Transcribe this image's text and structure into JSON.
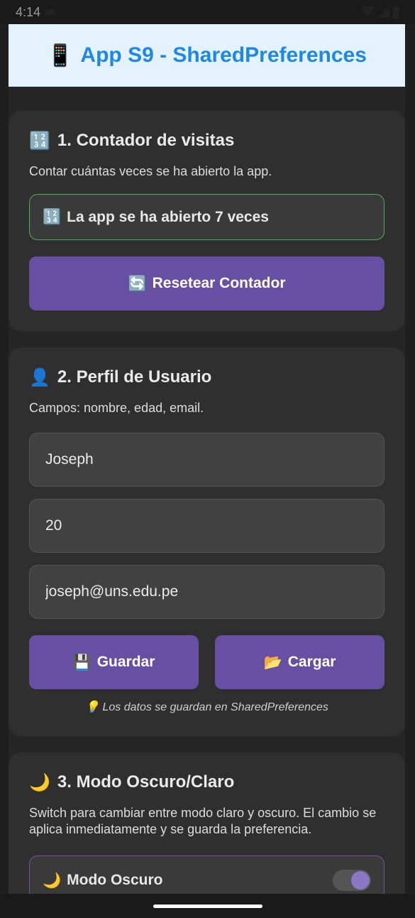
{
  "status_bar": {
    "time": "4:14"
  },
  "header": {
    "emoji": "📱",
    "title": "App S9 - SharedPreferences"
  },
  "counter_card": {
    "icon": "🔢",
    "title": "1. Contador de visitas",
    "description": "Contar cuántas veces se ha abierto la app.",
    "count_icon": "🔢",
    "count_text": "La app se ha abierto 7 veces",
    "count_border_color": "#4caf50",
    "reset_icon": "🔄",
    "reset_label": "Resetear Contador"
  },
  "profile_card": {
    "icon": "👤",
    "title": "2. Perfil de Usuario",
    "description": "Campos: nombre, edad, email.",
    "name_value": "Joseph",
    "age_value": "20",
    "email_value": "joseph@uns.edu.pe",
    "save_icon": "💾",
    "save_label": "Guardar",
    "load_icon": "📂",
    "load_label": "Cargar",
    "hint": "💡 Los datos se guardan en SharedPreferences"
  },
  "theme_card": {
    "icon": "🌙",
    "title": "3. Modo Oscuro/Claro",
    "description": "Switch para cambiar entre modo claro y oscuro. El cambio se aplica inmediatamente y se guarda la preferencia.",
    "switch_icon": "🌙",
    "switch_label": "Modo Oscuro",
    "switch_on": true
  },
  "colors": {
    "accent": "#6750a4",
    "header_bg": "#e3f2fd",
    "header_text": "#1e88e5"
  }
}
